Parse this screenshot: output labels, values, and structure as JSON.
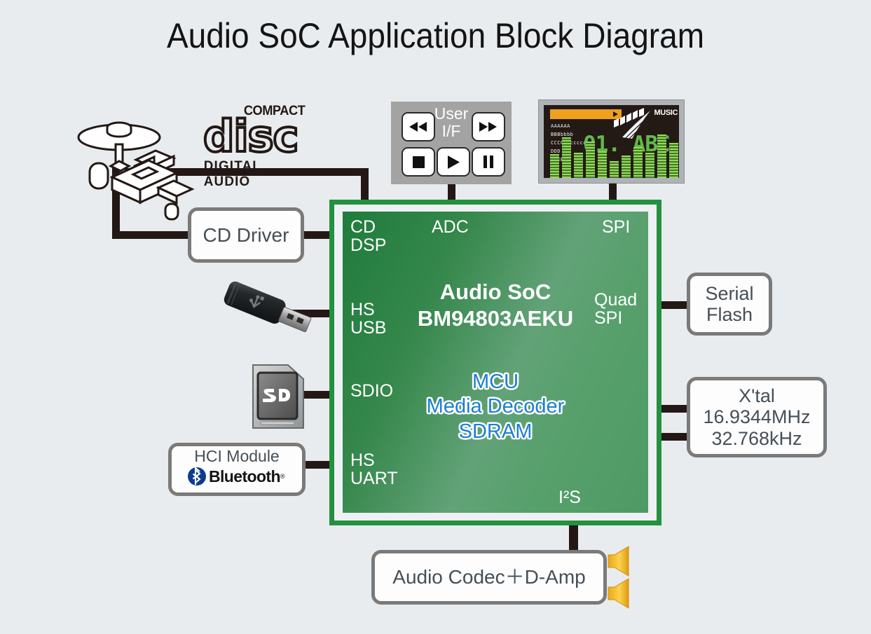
{
  "page": {
    "title": "Audio SoC Application Block Diagram",
    "background_color": "#e8ecef",
    "wire_color": "#231815"
  },
  "soc": {
    "name": "Audio SoC\nBM94803AEKU",
    "blocks": "MCU\nMedia Decoder\nSDRAM",
    "border_color": "#23913f",
    "label_color": "#ffffff",
    "blocks_color": "#1b7fd4",
    "pins": {
      "cd_dsp": "CD\nDSP",
      "adc": "ADC",
      "spi": "SPI",
      "hs_usb": "HS\nUSB",
      "quad_spi": "Quad\nSPI",
      "sdio": "SDIO",
      "hs_uart": "HS\nUART",
      "i2s": "I²S"
    }
  },
  "boxes": {
    "cd_driver": "CD Driver",
    "serial_flash": "Serial\nFlash",
    "xtal": "X'tal\n16.9344MHz\n32.768kHz",
    "audio_codec": "Audio Codec＋D-Amp",
    "hci_module": "HCI Module",
    "bluetooth": "Bluetooth",
    "bluetooth_reg": "®"
  },
  "user_if": {
    "label": "User\nI/F",
    "buttons": [
      {
        "name": "rewind",
        "glyph": "◀◀"
      },
      {
        "name": "fast-forward",
        "glyph": "▶▶"
      },
      {
        "name": "stop",
        "glyph": "■"
      },
      {
        "name": "play",
        "glyph": "▶"
      },
      {
        "name": "pause",
        "glyph": "▐▌"
      }
    ]
  },
  "lcd": {
    "logo_text": "MUSIC",
    "track_text": "01. ABC",
    "lines": [
      "AAAAAA",
      "BBBbbbb",
      "CCCCCcccccc",
      "DDD",
      "E_EE"
    ],
    "progress_color": "#efa01e",
    "text_color": "#66c44a",
    "equalizer": [
      34,
      58,
      36,
      52,
      38,
      24,
      32,
      44,
      36,
      62,
      50
    ]
  },
  "cd_logo": {
    "compact": "COMPACT",
    "disc": "disc",
    "digital_audio": "DIGITAL AUDIO"
  },
  "devices": {
    "cd_mechanism": "cd-mechanism",
    "usb_drive": "usb-flash-drive",
    "sd_card": "sd-card",
    "sd_label": "SD",
    "speaker": "speaker"
  }
}
